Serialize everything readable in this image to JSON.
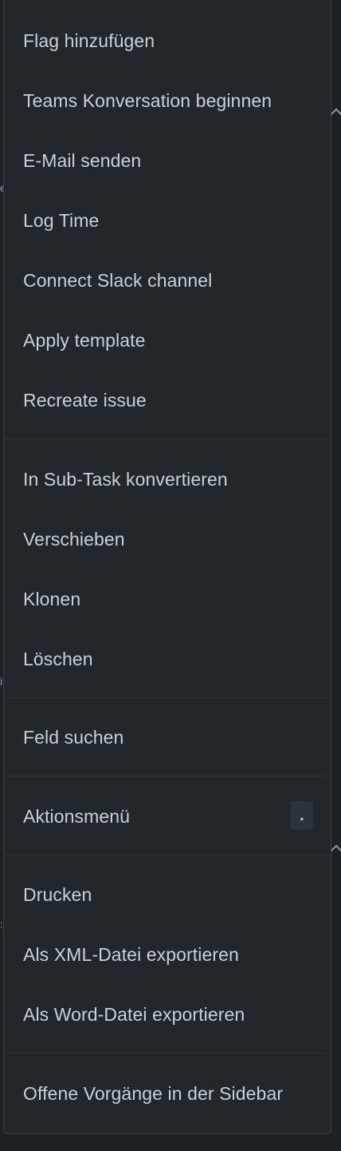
{
  "menu": {
    "group1": [
      {
        "id": "flag",
        "label": "Flag hinzufügen"
      },
      {
        "id": "teams",
        "label": "Teams Konversation beginnen"
      },
      {
        "id": "email",
        "label": "E-Mail senden"
      },
      {
        "id": "logtime",
        "label": "Log Time"
      },
      {
        "id": "slack",
        "label": "Connect Slack channel"
      },
      {
        "id": "template",
        "label": "Apply template"
      },
      {
        "id": "recreate",
        "label": "Recreate issue"
      }
    ],
    "group2": [
      {
        "id": "subtask",
        "label": "In Sub-Task konvertieren"
      },
      {
        "id": "move",
        "label": "Verschieben"
      },
      {
        "id": "clone",
        "label": "Klonen"
      },
      {
        "id": "delete",
        "label": "Löschen"
      }
    ],
    "group3": [
      {
        "id": "findfield",
        "label": "Feld suchen"
      }
    ],
    "group4": [
      {
        "id": "actions",
        "label": "Aktionsmenü",
        "shortcut": "."
      }
    ],
    "group5": [
      {
        "id": "print",
        "label": "Drucken"
      },
      {
        "id": "xml",
        "label": "Als XML-Datei exportieren"
      },
      {
        "id": "word",
        "label": "Als Word-Datei exportieren"
      }
    ],
    "group6": [
      {
        "id": "sidebar",
        "label": "Offene Vorgänge in der Sidebar"
      }
    ]
  },
  "colors": {
    "menu_background": "#22272b",
    "menu_border": "#3a4148",
    "text": "#c7d1db",
    "page_background": "#1d2125"
  }
}
